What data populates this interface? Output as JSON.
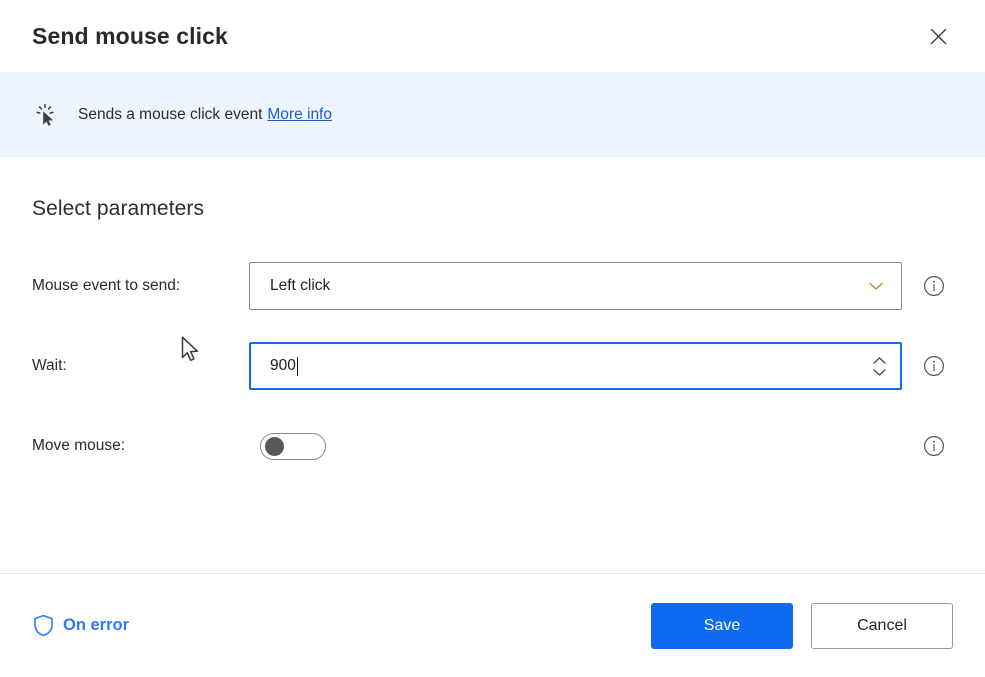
{
  "dialog": {
    "title": "Send mouse click",
    "close_icon": "close-icon"
  },
  "banner": {
    "icon": "mouse-click-cursor-icon",
    "text": "Sends a mouse click event",
    "link_label": "More info"
  },
  "section": {
    "title": "Select parameters"
  },
  "fields": [
    {
      "label": "Mouse event to send:",
      "type": "dropdown",
      "value": "Left click",
      "chevron_icon": "chevron-down-icon",
      "info_icon": "info-icon"
    },
    {
      "label": "Wait:",
      "type": "number",
      "value": "900",
      "spinner_up_icon": "chevron-up-icon",
      "spinner_down_icon": "chevron-down-icon",
      "info_icon": "info-icon"
    },
    {
      "label": "Move mouse:",
      "type": "toggle",
      "state": "off",
      "info_icon": "info-icon"
    }
  ],
  "footer": {
    "on_error_label": "On error",
    "shield_icon": "shield-icon",
    "save_label": "Save",
    "cancel_label": "Cancel"
  },
  "colors": {
    "accent_blue": "#0f6cf0",
    "link_blue": "#1a5fd0",
    "on_error_blue": "#2b7cf6",
    "banner_bg": "#eef4fd",
    "chevron_amber": "#c88a3d"
  },
  "cursor": {
    "icon": "mouse-pointer-icon"
  }
}
